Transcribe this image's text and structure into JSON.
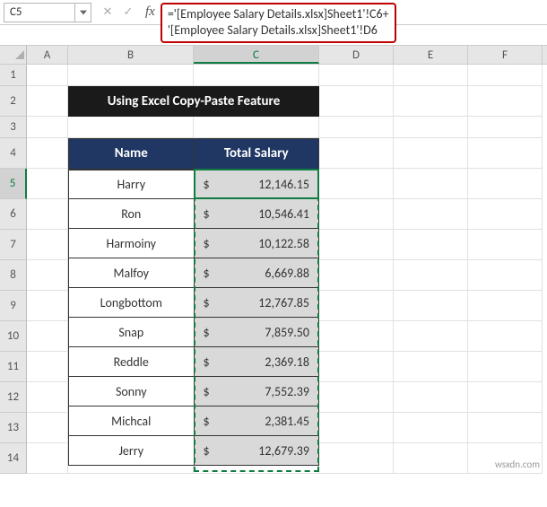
{
  "name_box": {
    "value": "C5"
  },
  "formula_bar": {
    "line1": "='[Employee Salary Details.xlsx]Sheet1'!C6+",
    "line2": "'[Employee Salary Details.xlsx]Sheet1'!D6"
  },
  "columns": [
    "A",
    "B",
    "C",
    "D",
    "E",
    "F"
  ],
  "rows": [
    "1",
    "2",
    "3",
    "4",
    "5",
    "6",
    "7",
    "8",
    "9",
    "10",
    "11",
    "12",
    "13",
    "14"
  ],
  "title_banner": "Using Excel Copy-Paste Feature",
  "headers": {
    "name": "Name",
    "salary": "Total Salary"
  },
  "currency_symbol": "$",
  "data": [
    {
      "name": "Harry",
      "salary": "12,146.15"
    },
    {
      "name": "Ron",
      "salary": "10,546.41"
    },
    {
      "name": "Harmoiny",
      "salary": "10,122.58"
    },
    {
      "name": "Malfoy",
      "salary": "6,669.88"
    },
    {
      "name": "Longbottom",
      "salary": "12,767.85"
    },
    {
      "name": "Snap",
      "salary": "7,859.50"
    },
    {
      "name": "Reddle",
      "salary": "2,369.18"
    },
    {
      "name": "Sonny",
      "salary": "7,552.39"
    },
    {
      "name": "Michcal",
      "salary": "2,381.45"
    },
    {
      "name": "Jerry",
      "salary": "12,679.39"
    }
  ],
  "watermark": "wsxdn.com"
}
